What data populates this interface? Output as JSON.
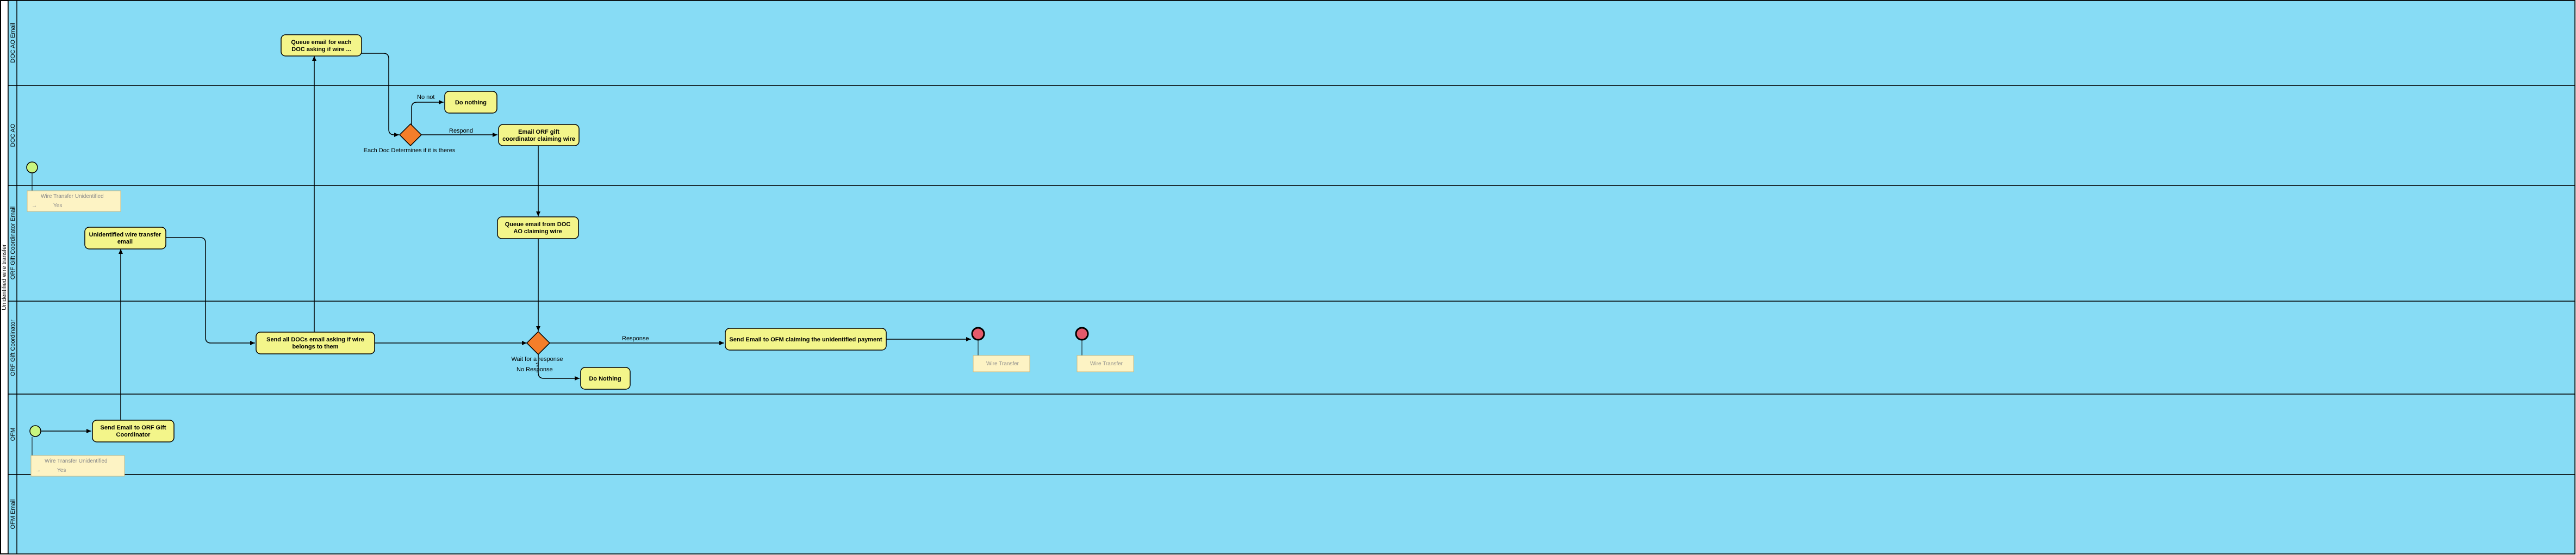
{
  "pool": {
    "title": "Unidentified wire transfer"
  },
  "lanes": [
    {
      "id": "doc_ao_email",
      "label": "DOC AO Email"
    },
    {
      "id": "doc_ao",
      "label": "DOC AO"
    },
    {
      "id": "orf_gift_email",
      "label": "ORF Gift Coordinator Email"
    },
    {
      "id": "orf_gift",
      "label": "ORF Gift Coordinator"
    },
    {
      "id": "ofm",
      "label": "OFM"
    },
    {
      "id": "ofm_email",
      "label": "OFM Email"
    }
  ],
  "tasks": {
    "queue_email_each_doc": [
      "Queue email for each",
      "DOC asking if wire ..."
    ],
    "do_nothing_top": [
      "Do nothing"
    ],
    "email_orf_claiming": [
      "Email ORF gift",
      "coordinator claiming wire"
    ],
    "queue_email_from_doc": [
      "Queue email from DOC",
      "AO claiming wire"
    ],
    "unidentified_wire_email": [
      "Unidentified wire transfer",
      "email"
    ],
    "send_all_docs": [
      "Send all DOCs email asking if wire",
      "belongs to them"
    ],
    "send_email_ofm": [
      "Send Email to OFM claiming the unidentified payment"
    ],
    "do_nothing_bottom": [
      "Do Nothing"
    ],
    "send_email_orf": [
      "Send Email to ORF Gift",
      "Coordinator"
    ]
  },
  "gateways": {
    "each_doc_determines": "Each Doc Determines if it is theres",
    "wait_for_response": [
      "Wait for a response",
      "?"
    ]
  },
  "edge_labels": {
    "no_not": "No not",
    "respond": "Respond",
    "response": "Response",
    "no_response": "No Response"
  },
  "annotations": {
    "data_orf": [
      "Wire Transfer Unidentified",
      "Yes"
    ],
    "data_ofm": [
      "Wire Transfer Unidentified",
      "Yes"
    ],
    "end_data_1": "Wire Transfer",
    "end_data_2": "Wire Transfer"
  },
  "colors": {
    "lane_fill": "#87dcf5",
    "task_fill": "#f3f58a",
    "gateway_fill": "#f47e2a",
    "start_fill": "#c8f580",
    "end_fill": "#e45a6b",
    "data_fill": "#fdf3c4"
  }
}
